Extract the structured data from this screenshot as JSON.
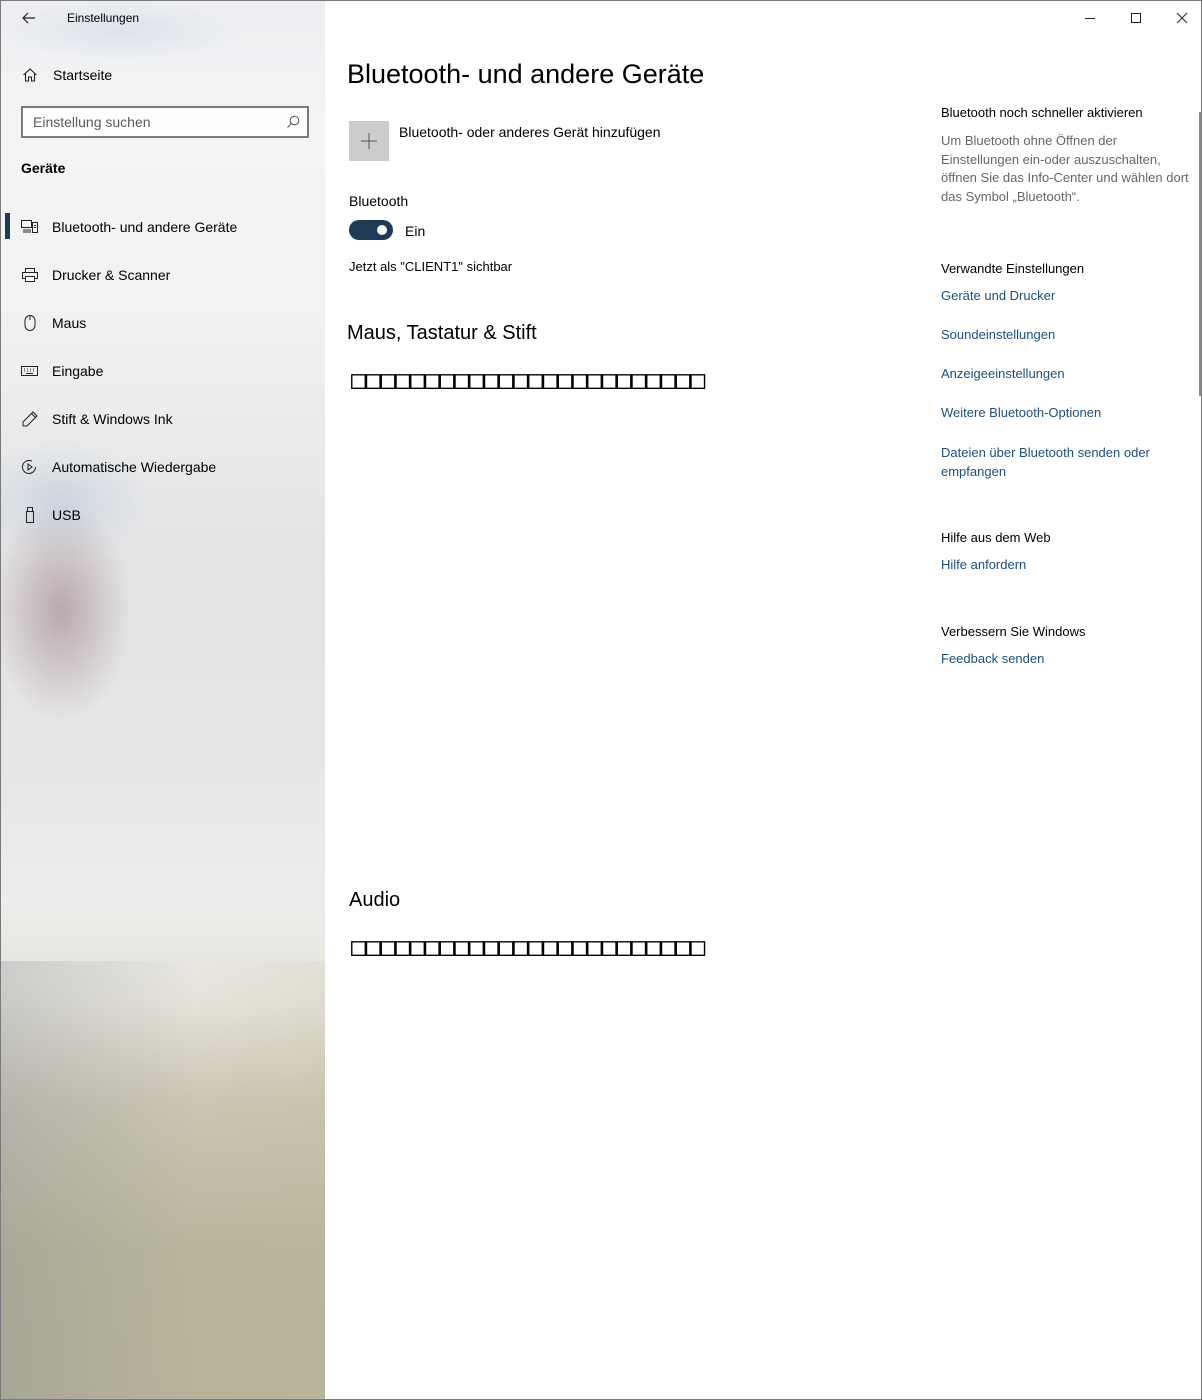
{
  "titlebar": {
    "app_title": "Einstellungen",
    "back_icon": "arrow-left-icon",
    "minimize_icon": "minimize-icon",
    "maximize_icon": "maximize-icon",
    "close_icon": "close-icon"
  },
  "sidebar": {
    "home_label": "Startseite",
    "search_placeholder": "Einstellung suchen",
    "section_heading": "Geräte",
    "items": [
      {
        "label": "Bluetooth- und andere Geräte",
        "icon": "bluetooth-devices-icon",
        "active": true
      },
      {
        "label": "Drucker & Scanner",
        "icon": "printer-icon",
        "active": false
      },
      {
        "label": "Maus",
        "icon": "mouse-icon",
        "active": false
      },
      {
        "label": "Eingabe",
        "icon": "keyboard-icon",
        "active": false
      },
      {
        "label": "Stift & Windows Ink",
        "icon": "pen-icon",
        "active": false
      },
      {
        "label": "Automatische Wiedergabe",
        "icon": "autoplay-icon",
        "active": false
      },
      {
        "label": "USB",
        "icon": "usb-icon",
        "active": false
      }
    ]
  },
  "main": {
    "page_title": "Bluetooth- und andere Geräte",
    "add_device_label": "Bluetooth- oder anderes Gerät hinzufügen",
    "bluetooth_label": "Bluetooth",
    "bluetooth_state": "Ein",
    "bluetooth_on": true,
    "visible_as": "Jetzt als \"CLIENT1\" sichtbar",
    "mouse_section_title": "Maus, Tastatur & Stift",
    "mouse_section_placeholder": "□□□□□□□□□□□□□□□□□□□□□□□□",
    "audio_section_title": "Audio",
    "audio_section_placeholder": "□□□□□□□□□□□□□□□□□□□□□□□□"
  },
  "aside": {
    "quick_title": "Bluetooth noch schneller aktivieren",
    "quick_desc": "Um Bluetooth ohne Öffnen der Einstellungen ein-oder auszuschalten, öffnen Sie das Info-Center und wählen dort das Symbol „Bluetooth“.",
    "related_title": "Verwandte Einstellungen",
    "related_links": [
      "Geräte und Drucker",
      "Soundeinstellungen",
      "Anzeigeeinstellungen",
      "Weitere Bluetooth-Optionen",
      "Dateien über Bluetooth senden oder empfangen"
    ],
    "help_title": "Hilfe aus dem Web",
    "help_link": "Hilfe anfordern",
    "improve_title": "Verbessern Sie Windows",
    "feedback_link": "Feedback senden"
  },
  "colors": {
    "accent": "#1e3a56",
    "link": "#1d4f7c",
    "secondary_text": "#666666"
  }
}
